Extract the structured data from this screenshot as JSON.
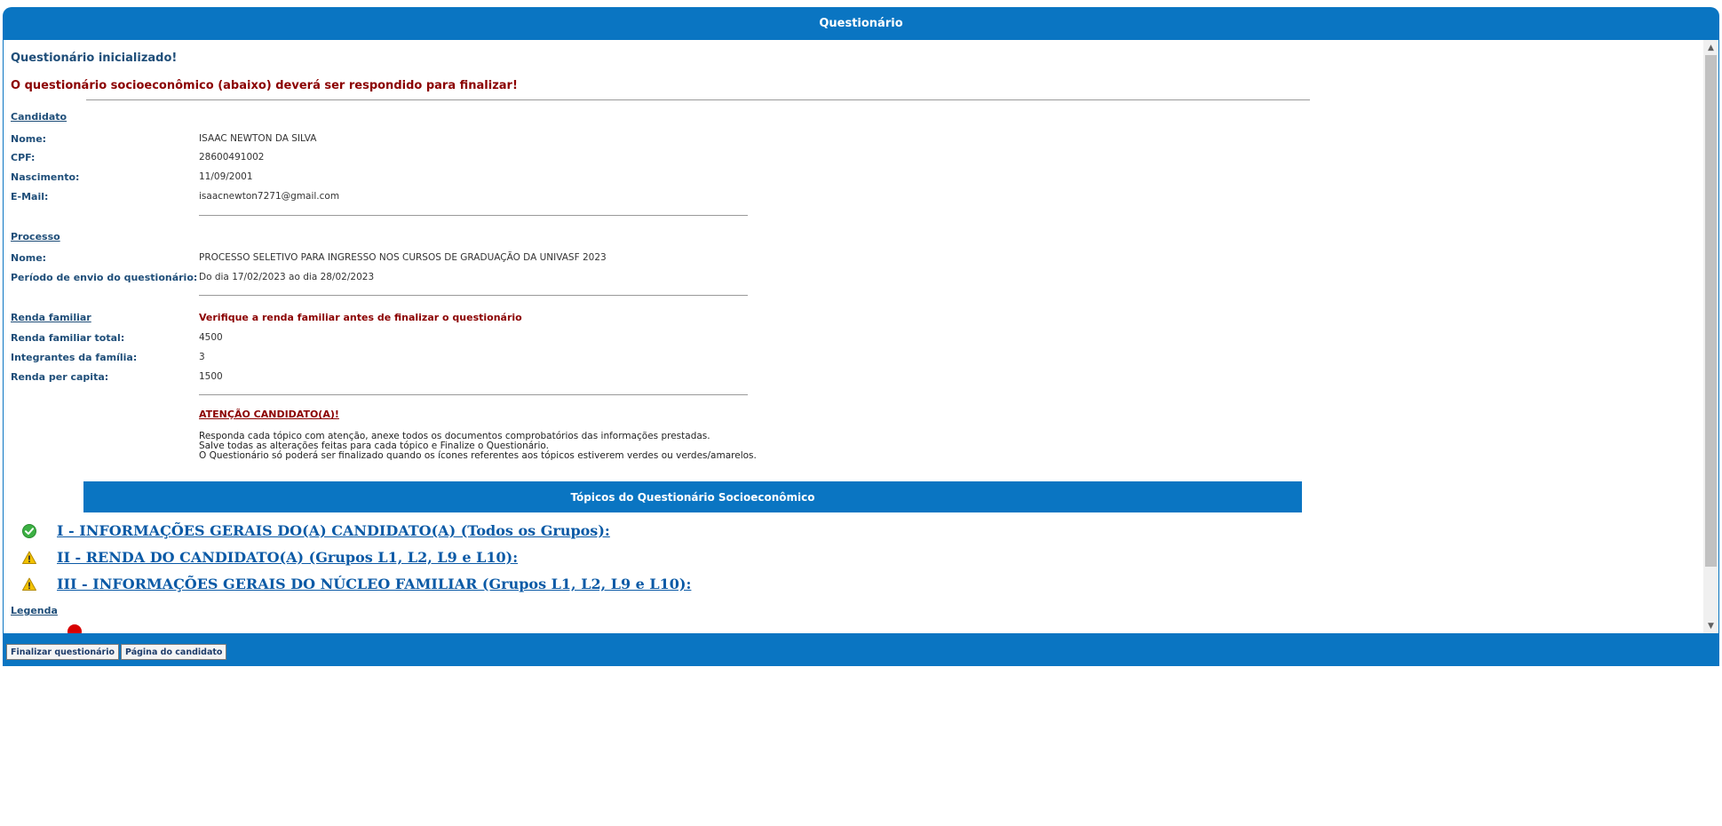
{
  "window": {
    "title": "Questionário"
  },
  "status": {
    "initialized": "Questionário inicializado!",
    "must_answer": "O questionário socioeconômico (abaixo) deverá ser respondido para finalizar!"
  },
  "candidate": {
    "section_label": "Candidato",
    "rows": [
      {
        "label": "Nome:",
        "value": "ISAAC NEWTON DA SILVA"
      },
      {
        "label": "CPF:",
        "value": "28600491002"
      },
      {
        "label": "Nascimento:",
        "value": "11/09/2001"
      },
      {
        "label": "E-Mail:",
        "value": "isaacnewton7271@gmail.com"
      }
    ]
  },
  "process": {
    "section_label": "Processo",
    "rows": [
      {
        "label": "Nome:",
        "value": "PROCESSO SELETIVO PARA INGRESSO NOS CURSOS DE GRADUAÇÃO DA UNIVASF 2023"
      },
      {
        "label": "Período de envio do questionário:",
        "value": "Do dia 17/02/2023 ao dia 28/02/2023"
      }
    ]
  },
  "income": {
    "section_label": "Renda familiar",
    "warning": "Verifique a renda familiar antes de finalizar o questionário",
    "rows": [
      {
        "label": "Renda familiar total:",
        "value": "4500"
      },
      {
        "label": "Integrantes da família:",
        "value": "3"
      },
      {
        "label": "Renda per capita:",
        "value": "1500"
      }
    ]
  },
  "attention": {
    "title": "ATENÇÃO CANDIDATO(A)!",
    "lines": [
      "Responda cada tópico com atenção, anexe todos os documentos comprobatórios das informações prestadas.",
      "Salve todas as alterações feitas para cada tópico e Finalize o Questionário.",
      "O Questionário só poderá ser finalizado quando os ícones referentes aos tópicos estiverem verdes ou verdes/amarelos."
    ]
  },
  "topics": {
    "header": "Tópicos do Questionário Socioeconômico",
    "items": [
      {
        "label": "I - INFORMAÇÕES GERAIS DO(A) CANDIDATO(A) (Todos os Grupos):",
        "status": "complete",
        "icon": "check-circle-icon",
        "color": "#3cb043"
      },
      {
        "label": "II - RENDA DO CANDIDATO(A) (Grupos L1, L2, L9 e L10):",
        "status": "pending",
        "icon": "warning-icon",
        "color": "#f2c200"
      },
      {
        "label": "III - INFORMAÇÕES GERAIS DO NÚCLEO FAMILIAR (Grupos L1, L2, L9 e L10):",
        "status": "pending",
        "icon": "warning-icon",
        "color": "#f2c200"
      }
    ]
  },
  "legend": {
    "label": "Legenda"
  },
  "footer": {
    "finalize": "Finalizar questionário",
    "candidate_page": "Página do candidato"
  },
  "colors": {
    "brand": "#0a75c2",
    "warning_text": "#8b0000",
    "label_text": "#1f4e79",
    "link": "#0b5aa6"
  }
}
